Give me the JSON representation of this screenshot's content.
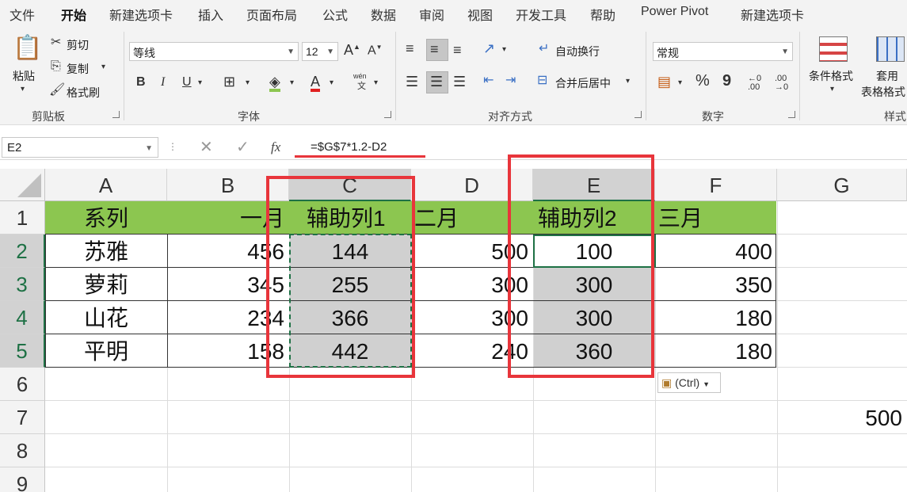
{
  "menu": {
    "tabs": [
      "文件",
      "开始",
      "新建选项卡",
      "插入",
      "页面布局",
      "公式",
      "数据",
      "审阅",
      "视图",
      "开发工具",
      "帮助",
      "Power Pivot",
      "新建选项卡"
    ],
    "active_index": 1
  },
  "ribbon": {
    "clipboard": {
      "paste": "粘贴",
      "cut": "剪切",
      "copy": "复制",
      "format_painter": "格式刷",
      "group_label": "剪贴板"
    },
    "font": {
      "font_name": "等线",
      "font_size": "12",
      "bold": "B",
      "italic": "I",
      "underline": "U",
      "wen": "wén",
      "wen_zi": "文",
      "group_label": "字体"
    },
    "alignment": {
      "wrap_text": "自动换行",
      "merge_center": "合并后居中",
      "group_label": "对齐方式"
    },
    "number": {
      "format": "常规",
      "percent": "%",
      "comma": "9",
      "inc_decimal": "←0 .00",
      "dec_decimal": ".00 →0",
      "group_label": "数字"
    },
    "styles": {
      "conditional_format": "条件格式",
      "table_format_1": "套用",
      "table_format_2": "表格格式",
      "group_label": "样式"
    }
  },
  "formula_bar": {
    "name_box": "E2",
    "fx": "fx",
    "formula": "=$G$7*1.2-D2"
  },
  "sheet": {
    "columns": [
      "A",
      "B",
      "C",
      "D",
      "E",
      "F",
      "G"
    ],
    "rows": [
      "1",
      "2",
      "3",
      "4",
      "5",
      "6",
      "7",
      "8",
      "9"
    ],
    "header_row": [
      "系列",
      "一月",
      "辅助列1",
      "二月",
      "辅助列2",
      "三月"
    ],
    "data": [
      [
        "苏雅",
        "456",
        "144",
        "500",
        "100",
        "400"
      ],
      [
        "萝莉",
        "345",
        "255",
        "300",
        "300",
        "350"
      ],
      [
        "山花",
        "234",
        "366",
        "300",
        "300",
        "180"
      ],
      [
        "平明",
        "158",
        "442",
        "240",
        "360",
        "180"
      ]
    ],
    "g7": "500",
    "paste_options": "(Ctrl)"
  },
  "colors": {
    "header_green": "#8cc650",
    "selection_green": "#1e7145",
    "highlight_red": "#e8353b",
    "helper_gray": "#d0d0d0"
  }
}
